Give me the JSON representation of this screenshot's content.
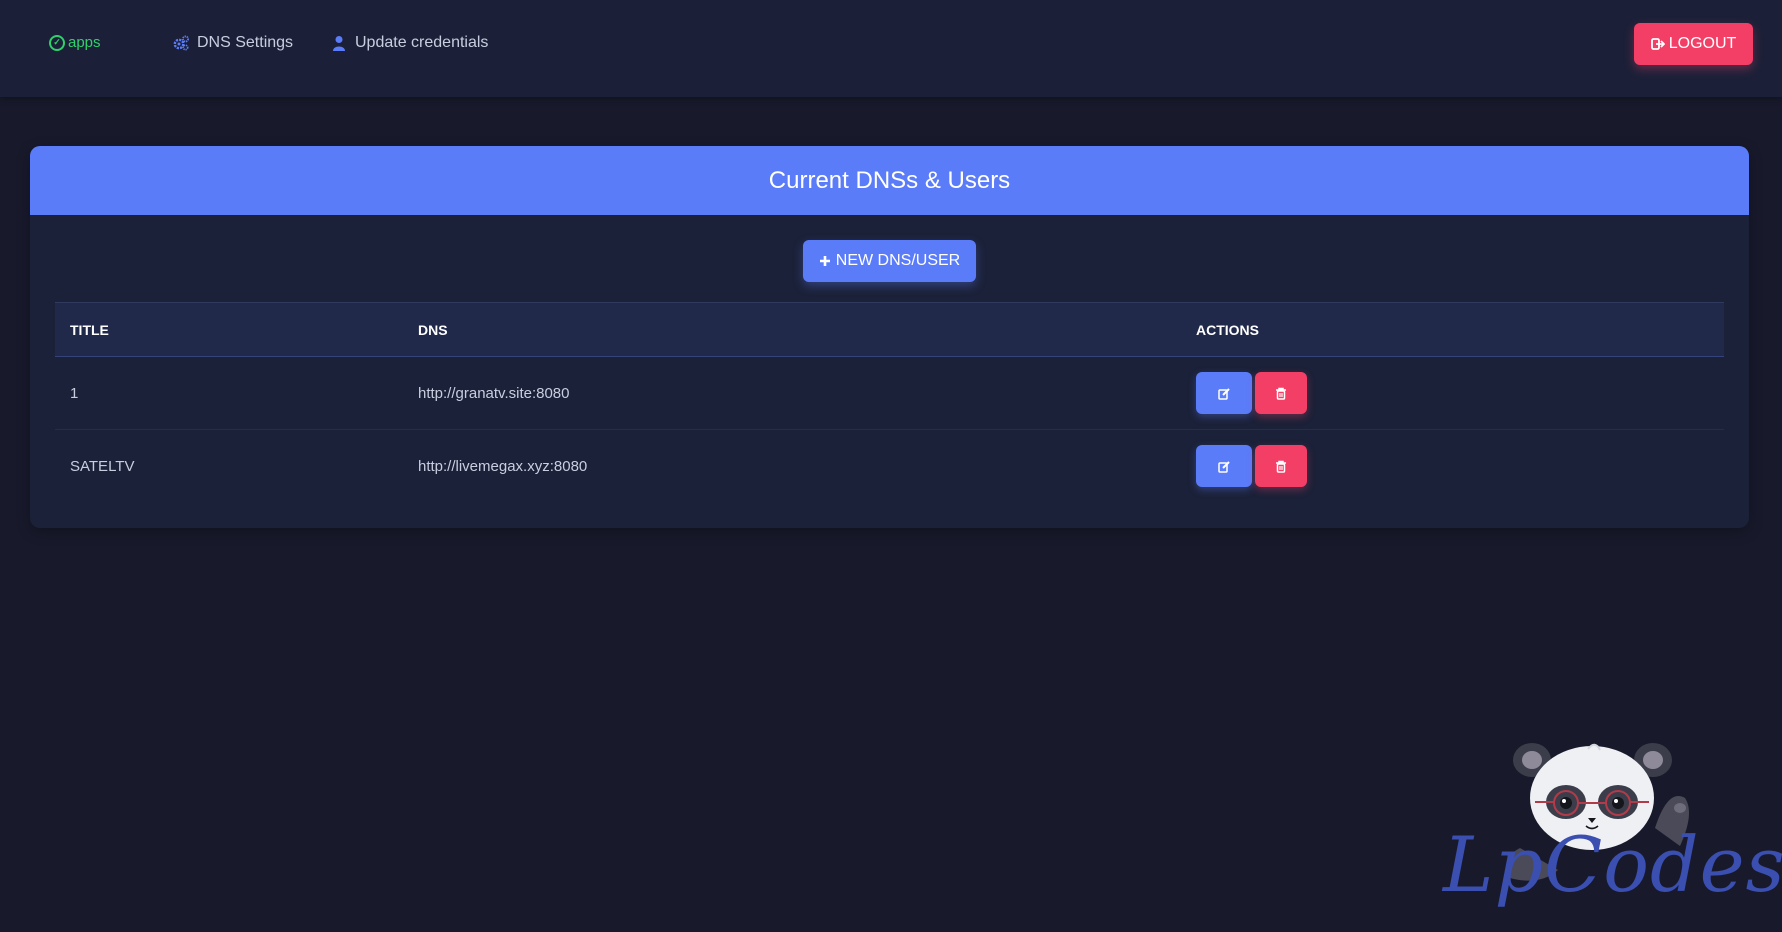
{
  "navbar": {
    "brand_text": "apps",
    "links": [
      {
        "label": "DNS Settings",
        "icon": "gears-icon"
      },
      {
        "label": "Update credentials",
        "icon": "user-icon"
      }
    ],
    "logout_label": "LOGOUT"
  },
  "card": {
    "title": "Current DNSs & Users",
    "new_button_label": "NEW DNS/USER"
  },
  "table": {
    "headers": [
      "TITLE",
      "DNS",
      "ACTIONS"
    ],
    "rows": [
      {
        "title": "1",
        "dns": "http://granatv.site:8080"
      },
      {
        "title": "SATELTV",
        "dns": "http://livemegax.xyz:8080"
      }
    ]
  },
  "watermark": {
    "text": "LpCodes"
  },
  "colors": {
    "accent": "#5b7cf9",
    "danger": "#f33f66",
    "background": "#181a2c",
    "brand_green": "#2fd16a"
  }
}
